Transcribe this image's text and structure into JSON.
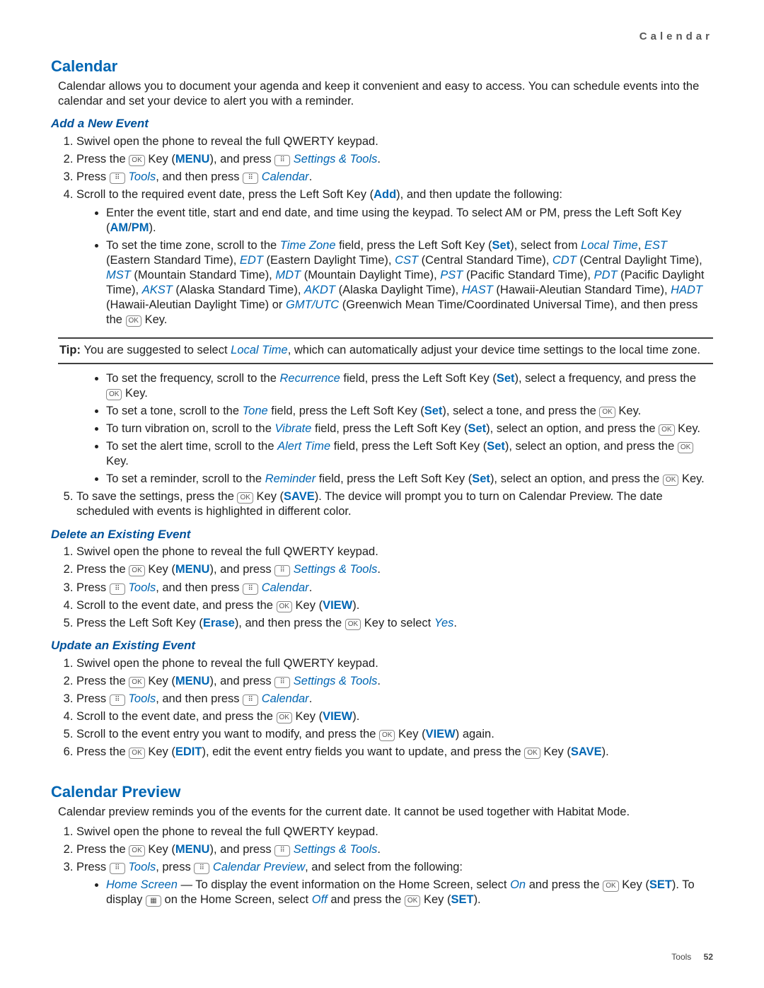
{
  "crumb": "Calendar",
  "footer_section": "Tools",
  "footer_page": "52",
  "sec1": {
    "title": "Calendar",
    "intro": "Calendar allows you to document your agenda and keep it convenient and easy to access. You can schedule events into the calendar and set your device to alert you with a reminder."
  },
  "add": {
    "title": "Add a New Event",
    "s1": "Swivel open the phone to reveal the full QWERTY keypad.",
    "s2a": "Press the ",
    "s2_key": "OK",
    "s2b": " Key (",
    "s2_menu": "MENU",
    "s2c": "), and press ",
    "s2_set": "Settings & Tools",
    "s2d": ".",
    "s3a": "Press ",
    "s3_tools": "Tools",
    "s3b": ", and then press ",
    "s3_cal": "Calendar",
    "s3c": ".",
    "s4a": "Scroll to the required event date, press the Left Soft Key (",
    "s4_add": "Add",
    "s4b": "), and then update the following:",
    "b1a": "Enter the event title, start and end date, and time using the keypad. To select AM or PM, press the Left Soft Key (",
    "b1_am": "AM",
    "b1_sep": "/",
    "b1_pm": "PM",
    "b1b": ").",
    "b2a": "To set the time zone, scroll to the ",
    "b2_tz": "Time Zone",
    "b2b": " field, press the Left Soft Key (",
    "b2_set": "Set",
    "b2c": "), select from ",
    "b2_lt": "Local Time",
    "b2_cm1": ", ",
    "b2_est": "EST",
    "b2_t1": " (Eastern Standard Time), ",
    "b2_edt": "EDT",
    "b2_t2": " (Eastern Daylight Time), ",
    "b2_cst": "CST",
    "b2_t3": " (Central Standard Time), ",
    "b2_cdt": "CDT",
    "b2_t4": " (Central Daylight Time), ",
    "b2_mst": "MST",
    "b2_t5": " (Mountain Standard Time), ",
    "b2_mdt": "MDT",
    "b2_t6": " (Mountain Daylight Time), ",
    "b2_pst": "PST",
    "b2_t7": " (Pacific Standard Time), ",
    "b2_pdt": "PDT",
    "b2_t8": " (Pacific Daylight Time), ",
    "b2_akst": "AKST",
    "b2_t9": " (Alaska Standard Time), ",
    "b2_akdt": "AKDT",
    "b2_t10": " (Alaska Daylight Time), ",
    "b2_hast": "HAST",
    "b2_t11": " (Hawaii-Aleutian Standard Time), ",
    "b2_hadt": "HADT",
    "b2_t12": " (Hawaii-Aleutian Daylight Time) or ",
    "b2_gmt": "GMT/UTC",
    "b2_t13": " (Greenwich Mean Time/Coordinated Universal Time), and then press the ",
    "b2_key": "OK",
    "b2_t14": " Key.",
    "tip_lbl": "Tip: ",
    "tip1": "You are suggested to select ",
    "tip_lt": "Local Time",
    "tip2": ", which can automatically adjust your device time settings to the local time zone.",
    "b3a": "To set the frequency, scroll to the ",
    "b3_rec": "Recurrence",
    "b3b": " field, press the Left Soft Key (",
    "b3_set": "Set",
    "b3c": "), select a frequency, and press the ",
    "b3_key": "OK",
    "b3d": " Key.",
    "b4a": "To set a tone, scroll to the ",
    "b4_tone": "Tone",
    "b4b": " field, press the Left Soft Key (",
    "b4_set": "Set",
    "b4c": "), select a tone, and press the ",
    "b4_key": "OK",
    "b4d": " Key.",
    "b5a": "To turn vibration on, scroll to the ",
    "b5_vib": "Vibrate",
    "b5b": " field, press the Left Soft Key (",
    "b5_set": "Set",
    "b5c": "), select an option, and press the ",
    "b5_key": "OK",
    "b5d": " Key.",
    "b6a": "To set the alert time, scroll to the ",
    "b6_al": "Alert Time",
    "b6b": " field, press the Left Soft Key (",
    "b6_set": "Set",
    "b6c": "), select an option, and press the ",
    "b6_key": "OK",
    "b6d": " Key.",
    "b7a": "To set a reminder, scroll to the ",
    "b7_rm": "Reminder",
    "b7b": " field, press the Left Soft Key (",
    "b7_set": "Set",
    "b7c": "), select an option, and press the ",
    "b7_key": "OK",
    "b7d": " Key.",
    "s5a": "To save the settings, press the ",
    "s5_key": "OK",
    "s5b": " Key (",
    "s5_save": "SAVE",
    "s5c": "). The device will prompt you to turn on Calendar Preview. The date scheduled with events is highlighted in different color."
  },
  "del": {
    "title": "Delete an Existing Event",
    "s1": "Swivel open the phone to reveal the full QWERTY keypad.",
    "s2a": "Press the ",
    "s2_key": "OK",
    "s2b": " Key (",
    "s2_menu": "MENU",
    "s2c": "), and press ",
    "s2_set": "Settings & Tools",
    "s2d": ".",
    "s3a": "Press ",
    "s3_tools": "Tools",
    "s3b": ", and then press ",
    "s3_cal": "Calendar",
    "s3c": ".",
    "s4a": "Scroll to the event date, and press the ",
    "s4_key": "OK",
    "s4b": " Key (",
    "s4_view": "VIEW",
    "s4c": ").",
    "s5a": "Press the Left Soft Key (",
    "s5_er": "Erase",
    "s5b": "), and then press the ",
    "s5_key": "OK",
    "s5c": " Key to select ",
    "s5_yes": "Yes",
    "s5d": "."
  },
  "upd": {
    "title": "Update an Existing Event",
    "s1": "Swivel open the phone to reveal the full QWERTY keypad.",
    "s2a": "Press the ",
    "s2_key": "OK",
    "s2b": " Key (",
    "s2_menu": "MENU",
    "s2c": "), and press ",
    "s2_set": "Settings & Tools",
    "s2d": ".",
    "s3a": "Press ",
    "s3_tools": "Tools",
    "s3b": ", and then press ",
    "s3_cal": "Calendar",
    "s3c": ".",
    "s4a": "Scroll to the event date, and press the ",
    "s4_key": "OK",
    "s4b": " Key (",
    "s4_view": "VIEW",
    "s4c": ").",
    "s5a": "Scroll to the event entry you want to modify, and press the ",
    "s5_key": "OK",
    "s5b": " Key (",
    "s5_view": "VIEW",
    "s5c": ") again.",
    "s6a": "Press the ",
    "s6_key1": "OK",
    "s6b": " Key (",
    "s6_edit": "EDIT",
    "s6c": "), edit the event entry fields you want to update, and press the ",
    "s6_key2": "OK",
    "s6d": " Key (",
    "s6_save": "SAVE",
    "s6e": ")."
  },
  "prev": {
    "title": "Calendar Preview",
    "intro": "Calendar preview reminds you of the events for the current date. It cannot be used together with Habitat Mode.",
    "s1": "Swivel open the phone to reveal the full QWERTY keypad.",
    "s2a": "Press the ",
    "s2_key": "OK",
    "s2b": " Key (",
    "s2_menu": "MENU",
    "s2c": "), and press ",
    "s2_set": "Settings & Tools",
    "s2d": ".",
    "s3a": "Press ",
    "s3_tools": "Tools",
    "s3b": ", press ",
    "s3_cp": "Calendar Preview",
    "s3c": ", and select from the following:",
    "b1_hs": "Home Screen",
    "b1a": " — To display the event information on the Home Screen, select ",
    "b1_on": "On",
    "b1b": " and press the ",
    "b1_key1": "OK",
    "b1c": " Key (",
    "b1_set1": "SET",
    "b1d": "). To display ",
    "b1_icon": "▦",
    "b1e": " on the Home Screen, select ",
    "b1_off": "Off",
    "b1f": " and press the ",
    "b1_key2": "OK",
    "b1g": " Key (",
    "b1_set2": "SET",
    "b1h": ")."
  }
}
